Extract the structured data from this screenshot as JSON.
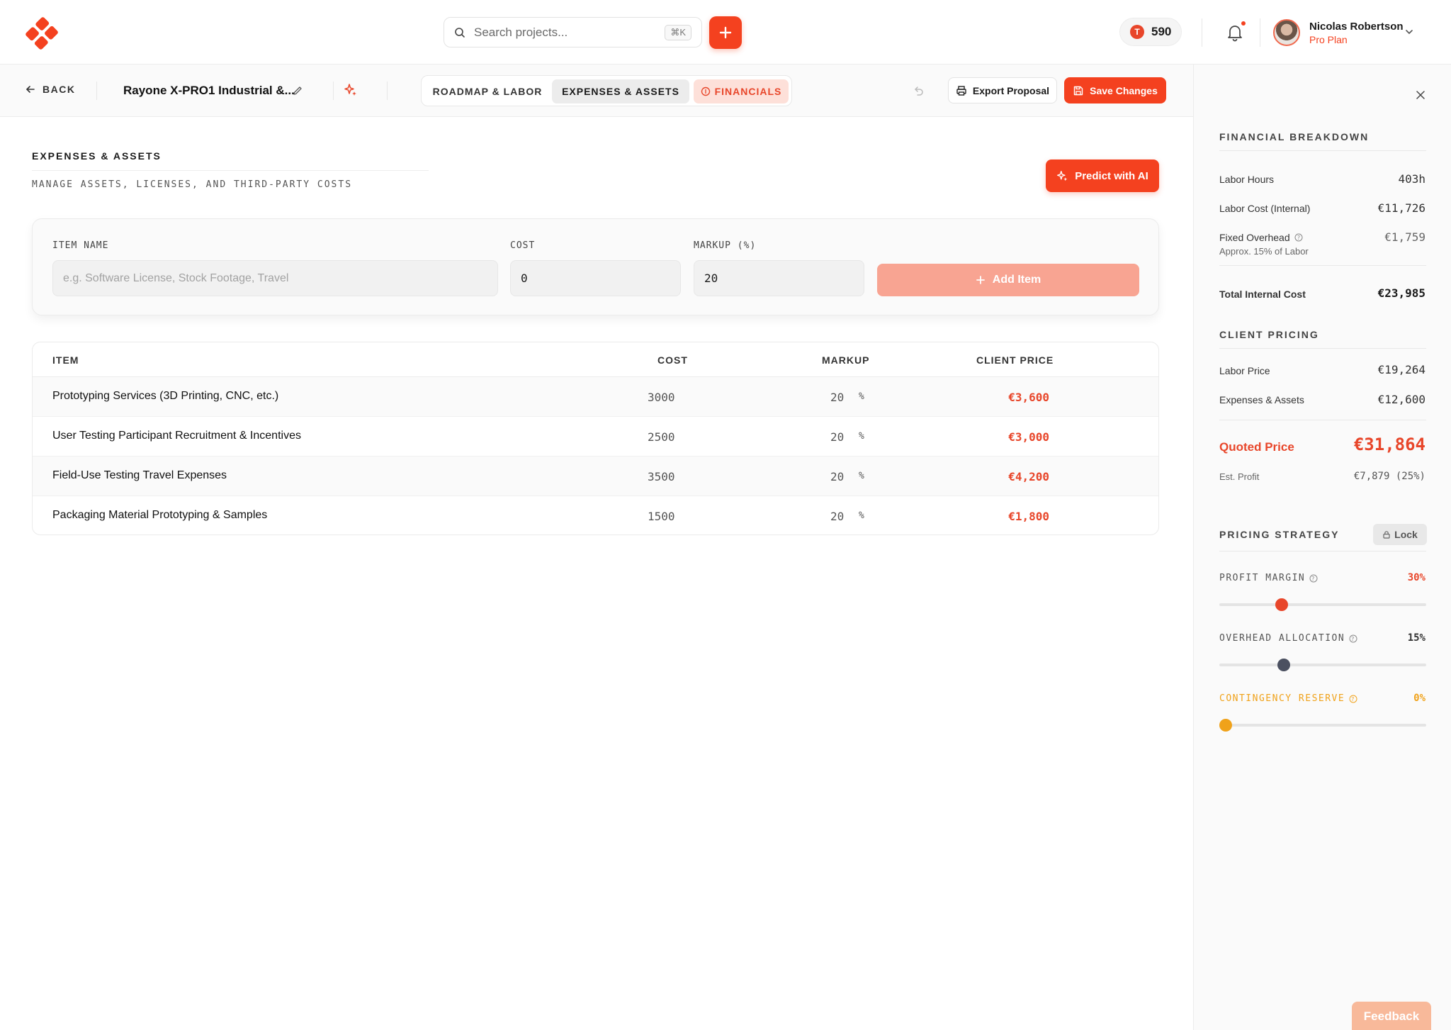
{
  "header": {
    "search_placeholder": "Search projects...",
    "search_shortcut": "⌘K",
    "tokens": "590",
    "token_badge": "T",
    "user_name": "Nicolas Robertson",
    "user_plan": "Pro Plan"
  },
  "subbar": {
    "back_label": "BACK",
    "project_title": "Rayone X-PRO1 Industrial &...",
    "tabs": [
      {
        "label": "ROADMAP & LABOR"
      },
      {
        "label": "EXPENSES & ASSETS"
      },
      {
        "label": "FINANCIALS"
      }
    ],
    "export_label": "Export Proposal",
    "save_label": "Save Changes"
  },
  "section": {
    "title": "EXPENSES & ASSETS",
    "subtitle": "MANAGE ASSETS, LICENSES, AND THIRD-PARTY COSTS",
    "ai_button": "Predict with AI"
  },
  "form": {
    "item_label": "ITEM NAME",
    "item_placeholder": "e.g. Software License, Stock Footage, Travel",
    "cost_label": "COST",
    "cost_value": "0",
    "markup_label": "MARKUP (%)",
    "markup_value": "20",
    "add_button": "Add Item"
  },
  "table": {
    "headers": {
      "item": "ITEM",
      "cost": "COST",
      "markup": "MARKUP",
      "price": "CLIENT PRICE"
    },
    "rows": [
      {
        "item": "Prototyping Services (3D Printing, CNC, etc.)",
        "cost": "3000",
        "markup": "20",
        "pct": "%",
        "price": "€3,600"
      },
      {
        "item": "User Testing Participant Recruitment & Incentives",
        "cost": "2500",
        "markup": "20",
        "pct": "%",
        "price": "€3,000"
      },
      {
        "item": "Field-Use Testing Travel Expenses",
        "cost": "3500",
        "markup": "20",
        "pct": "%",
        "price": "€4,200"
      },
      {
        "item": "Packaging Material Prototyping & Samples",
        "cost": "1500",
        "markup": "20",
        "pct": "%",
        "price": "€1,800"
      }
    ]
  },
  "panel": {
    "breakdown_title": "FINANCIAL BREAKDOWN",
    "labor_hours_label": "Labor Hours",
    "labor_hours_value": "403h",
    "labor_cost_label": "Labor Cost (Internal)",
    "labor_cost_value": "€11,726",
    "overhead_label": "Fixed Overhead",
    "overhead_value": "€1,759",
    "overhead_note": "Approx. 15% of Labor",
    "total_label": "Total Internal Cost",
    "total_value": "€23,985",
    "client_title": "CLIENT PRICING",
    "labor_price_label": "Labor Price",
    "labor_price_value": "€19,264",
    "expenses_label": "Expenses & Assets",
    "expenses_value": "€12,600",
    "quoted_label": "Quoted Price",
    "quoted_value": "€31,864",
    "profit_label": "Est. Profit",
    "profit_value": "€7,879 (25%)",
    "strategy_title": "PRICING STRATEGY",
    "lock_label": "Lock",
    "sliders": [
      {
        "label": "PROFIT MARGIN",
        "value": "30%",
        "fraction": 0.3,
        "color": "#e8462a"
      },
      {
        "label": "OVERHEAD ALLOCATION",
        "value": "15%",
        "fraction": 0.31,
        "color": "#4b5060"
      },
      {
        "label": "CONTINGENCY RESERVE",
        "value": "0%",
        "fraction": 0.03,
        "color": "#f0a21a"
      }
    ],
    "feedback": "Feedback"
  },
  "colors": {
    "accent": "#f4411f",
    "accent_soft": "#fde0d9"
  }
}
